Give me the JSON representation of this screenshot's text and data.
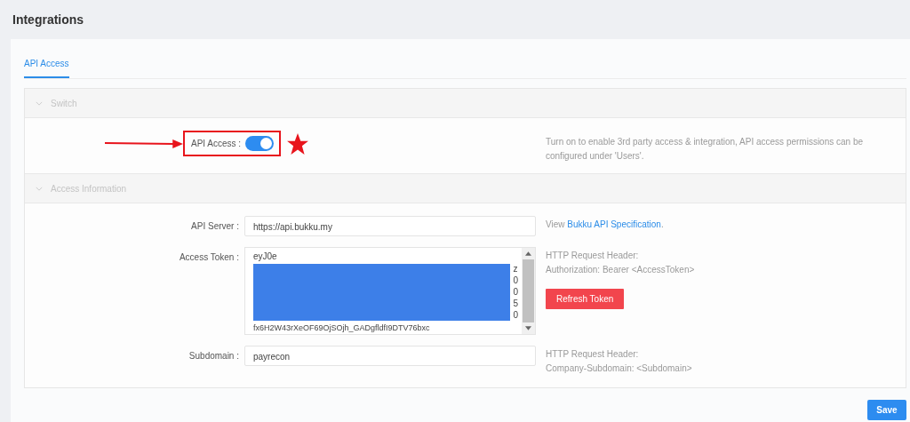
{
  "page": {
    "title": "Integrations"
  },
  "tabs": [
    {
      "label": "API Access",
      "selected": true
    }
  ],
  "sections": [
    {
      "kind": "switch",
      "title": "Switch",
      "expanded": true,
      "label": "API Access :",
      "on": true,
      "help": "Turn on to enable 3rd party access & integration, API access permissions can be configured under 'Users'."
    },
    {
      "kind": "fields",
      "title": "Access Information",
      "expanded": true,
      "fields": [
        {
          "kind": "input",
          "label": "API Server :",
          "value": "https://api.bukku.my",
          "help_prefix": "View ",
          "help_link": "Bukku API Specification",
          "help_suffix": "."
        },
        {
          "kind": "token",
          "label": "Access Token :",
          "first_line": "eyJ0e",
          "line_ends": [
            "z",
            "0",
            "0",
            "5",
            "0"
          ],
          "last_line": "fx6H2W43rXeOF69OjSOjh_GADgfldfI9DTV76bxc",
          "help_lines": [
            "HTTP Request Header:",
            "Authorization: Bearer <AccessToken>"
          ],
          "button": "Refresh Token"
        },
        {
          "kind": "input",
          "label": "Subdomain :",
          "value": "payrecon",
          "help_lines": [
            "HTTP Request Header:",
            "Company-Subdomain: <Subdomain>"
          ]
        }
      ]
    }
  ],
  "save_button": "Save"
}
